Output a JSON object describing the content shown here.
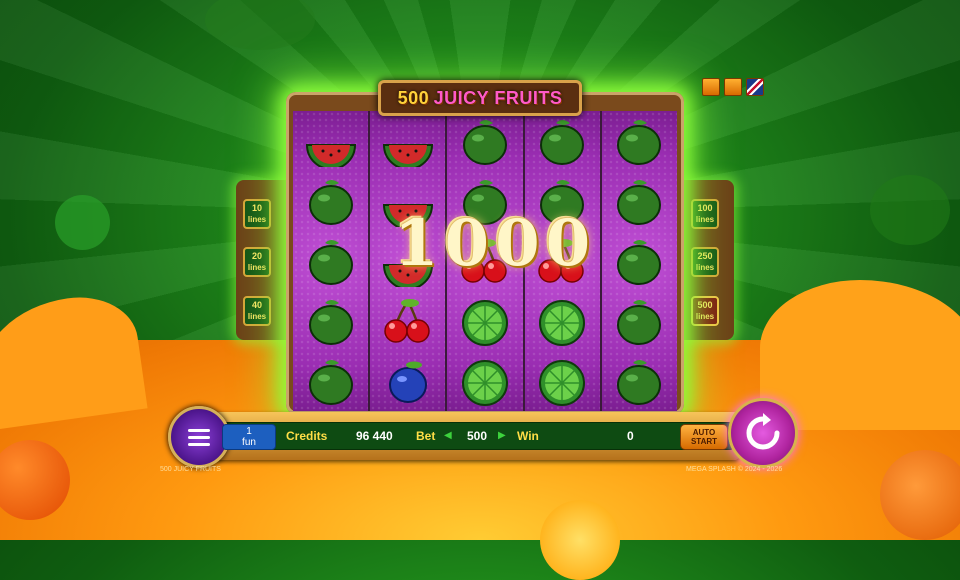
{
  "game": {
    "title_num": "500",
    "title_word": "JUICY FRUITS",
    "big_win": "1000",
    "footer_left": "500 JUICY FRUITS",
    "footer_right": "MEGA SPLASH © 2024 - 2026"
  },
  "lines": {
    "left": [
      {
        "n": "10",
        "t": "lines"
      },
      {
        "n": "20",
        "t": "lines"
      },
      {
        "n": "40",
        "t": "lines"
      }
    ],
    "right": [
      {
        "n": "100",
        "t": "lines"
      },
      {
        "n": "250",
        "t": "lines"
      },
      {
        "n": "500",
        "t": "lines"
      }
    ]
  },
  "bar": {
    "coin_value": "1",
    "coin_unit": "fun",
    "credits_label": "Credits",
    "credits_value": "96 440",
    "bet_label": "Bet",
    "bet_value": "500",
    "win_label": "Win",
    "win_value": "0",
    "auto_label_1": "AUTO",
    "auto_label_2": "START"
  },
  "reels": [
    [
      "watermelon",
      "green-fruit",
      "green-fruit",
      "green-fruit",
      "green-fruit"
    ],
    [
      "watermelon",
      "watermelon",
      "watermelon",
      "cherry",
      "plum"
    ],
    [
      "green-fruit",
      "green-fruit",
      "cherry",
      "lime",
      "lime"
    ],
    [
      "green-fruit",
      "green-fruit",
      "cherry",
      "lime",
      "lime"
    ],
    [
      "green-fruit",
      "green-fruit",
      "green-fruit",
      "green-fruit",
      "green-fruit"
    ]
  ],
  "colors": {
    "accent": "#ffde47",
    "frame": "#7a4a1c",
    "reel": "#9a2fb0",
    "spin": "#b0249f"
  }
}
